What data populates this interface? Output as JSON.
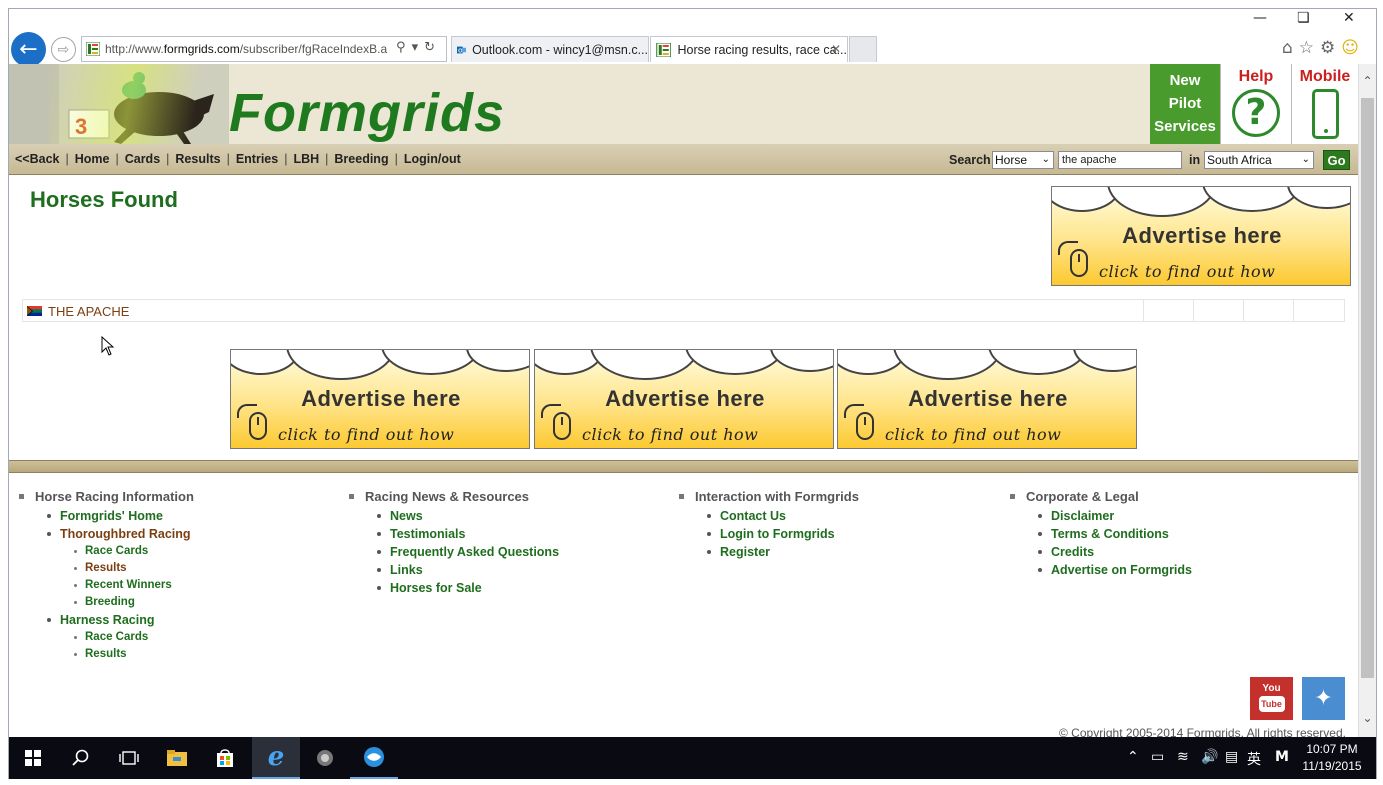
{
  "browser": {
    "window_controls": {
      "minimize": "—",
      "restore": "❏",
      "close": "✕"
    },
    "address": {
      "url_prefix": "http://www.",
      "url_domain": "formgrids.com",
      "url_rest": "/subscriber/fgRaceIndexB.a"
    },
    "tabs": [
      {
        "label": "Outlook.com - wincy1@msn.c...",
        "active": false
      },
      {
        "label": "Horse racing results, race ca...",
        "active": true
      }
    ],
    "toolbar_icons": [
      "home-icon",
      "favorites-star-icon",
      "settings-gear-icon",
      "smiley-feedback-icon"
    ]
  },
  "header": {
    "logo": "Formgrids",
    "new_pilot": [
      "New",
      "Pilot",
      "Services"
    ],
    "help": "Help",
    "mobile": "Mobile"
  },
  "nav": {
    "links": [
      "<<Back",
      "Home",
      "Cards",
      "Results",
      "Entries",
      "LBH",
      "Breeding",
      "Login/out"
    ],
    "search_label": "Search",
    "search_type": "Horse",
    "search_value": "the apache",
    "in_label": "in",
    "country": "South Africa",
    "go": "Go"
  },
  "main": {
    "title": "Horses Found",
    "results": [
      {
        "name": "THE APACHE",
        "country_flag": "south-africa-flag-icon"
      }
    ],
    "ads": {
      "headline": "Advertise here",
      "subline": "click to find out how"
    }
  },
  "footer": {
    "columns": [
      {
        "heading": "Horse Racing Information",
        "items": [
          {
            "label": "Formgrids' Home",
            "level": 1
          },
          {
            "label": "Thoroughbred Racing",
            "level": 1
          },
          {
            "label": "Race Cards",
            "level": 2
          },
          {
            "label": "Results",
            "level": 2
          },
          {
            "label": "Recent Winners",
            "level": 2
          },
          {
            "label": "Breeding",
            "level": 2
          },
          {
            "label": "Harness Racing",
            "level": 1
          },
          {
            "label": "Race Cards",
            "level": 2
          },
          {
            "label": "Results",
            "level": 2
          }
        ]
      },
      {
        "heading": "Racing News & Resources",
        "items": [
          {
            "label": "News",
            "level": 1
          },
          {
            "label": "Testimonials",
            "level": 1
          },
          {
            "label": "Frequently Asked Questions",
            "level": 1
          },
          {
            "label": "Links",
            "level": 1
          },
          {
            "label": "Horses for Sale",
            "level": 1
          }
        ]
      },
      {
        "heading": "Interaction with Formgrids",
        "items": [
          {
            "label": "Contact Us",
            "level": 1
          },
          {
            "label": "Login to Formgrids",
            "level": 1
          },
          {
            "label": "Register",
            "level": 1
          }
        ]
      },
      {
        "heading": "Corporate & Legal",
        "items": [
          {
            "label": "Disclaimer",
            "level": 1
          },
          {
            "label": "Terms & Conditions",
            "level": 1
          },
          {
            "label": "Credits",
            "level": 1
          },
          {
            "label": "Advertise on Formgrids",
            "level": 1
          }
        ]
      }
    ],
    "youtube": {
      "top": "You",
      "bottom": "Tube"
    },
    "copyright": "© Copyright 2005-2014 Formgrids. All rights reserved."
  },
  "taskbar": {
    "clock_time": "10:07 PM",
    "clock_date": "11/19/2015",
    "ime": "英",
    "ime2": "M"
  }
}
